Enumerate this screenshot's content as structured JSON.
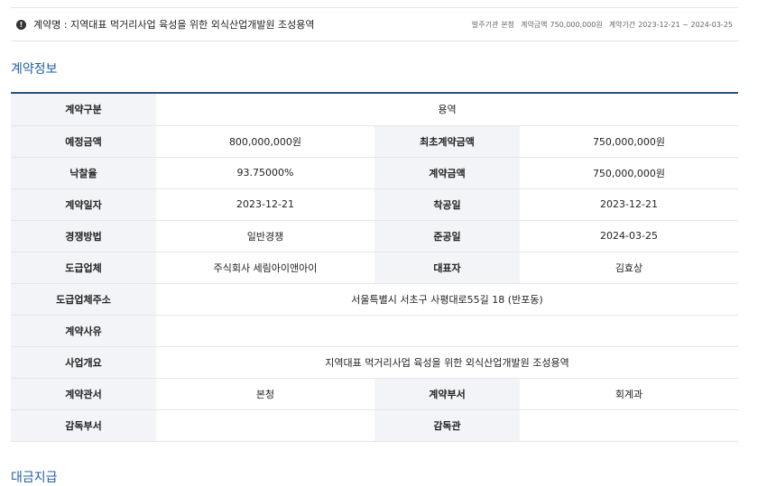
{
  "summary": {
    "icon": "alert-icon",
    "title": "계약명 : 지역대표 먹거리사업 육성을 위한 외식산업개발원 조성용역",
    "meta": [
      {
        "label": "발주기관",
        "value": "본청"
      },
      {
        "label": "계약금액",
        "value": "750,000,000원"
      },
      {
        "label": "계약기간",
        "value": "2023-12-21 ~ 2024-03-25"
      }
    ]
  },
  "section_title": "계약정보",
  "rows": [
    {
      "l1": "계약구분",
      "v1": "용역"
    },
    {
      "l1": "예정금액",
      "v1": "800,000,000원",
      "l2": "최초계약금액",
      "v2": "750,000,000원"
    },
    {
      "l1": "낙찰율",
      "v1": "93.75000%",
      "l2": "계약금액",
      "v2": "750,000,000원"
    },
    {
      "l1": "계약일자",
      "v1": "2023-12-21",
      "l2": "착공일",
      "v2": "2023-12-21"
    },
    {
      "l1": "경쟁방법",
      "v1": "일반경쟁",
      "l2": "준공일",
      "v2": "2024-03-25"
    },
    {
      "l1": "도급업체",
      "v1": "주식회사 세림아이앤아이",
      "l2": "대표자",
      "v2": "김효상"
    },
    {
      "l1": "도급업체주소",
      "v1": "서울특별시 서초구 사평대로55길 18 (반포동)"
    },
    {
      "l1": "계약사유",
      "v1": ""
    },
    {
      "l1": "사업개요",
      "v1": "지역대표 먹거리사업 육성을 위한 외식산업개발원 조성용역"
    },
    {
      "l1": "계약관서",
      "v1": "본청",
      "l2": "계약부서",
      "v2": "회계과"
    },
    {
      "l1": "감독부서",
      "v1": "",
      "l2": "감독관",
      "v2": ""
    }
  ],
  "next_section_title": "대금지급"
}
